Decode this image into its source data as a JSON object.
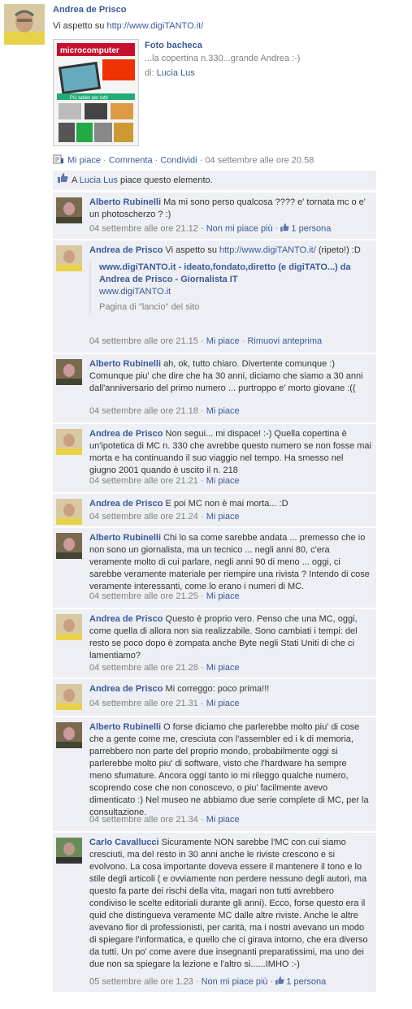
{
  "post": {
    "author": "Andrea de Prisco",
    "text_prefix": "Vi aspetto su ",
    "text_link": "http://www.digiTANTO.it/",
    "attachment": {
      "title": "Foto bacheca",
      "caption": "...la copertina n.330...grande Andrea :-)",
      "by_label": "di:",
      "by_name": "Lucia Lus",
      "thumb_masthead": "microcomputer",
      "thumb_subtitle": "Più tablet per tutti"
    },
    "actions": {
      "like": "Mi piace",
      "comment": "Commenta",
      "share": "Condividi",
      "timestamp": "04 settembre alle ore 20.58",
      "sep": "·"
    },
    "likes": {
      "prefix": "A",
      "name": "Lucia Lus",
      "suffix": "piace questo elemento."
    }
  },
  "comments": [
    {
      "author": "Alberto Rubinelli",
      "text": "Ma mi sono perso qualcosa ???? e' tornata mc o e' un photoscherzo ? :)",
      "time": "04 settembre alle ore 21.12",
      "actions": [
        "Non mi piace più"
      ],
      "likes_count": "1 persona"
    },
    {
      "author": "Andrea de Prisco",
      "text": "Vi aspetto su ",
      "link": "http://www.digiTANTO.it/",
      "text_after": " (ripeto!) :D",
      "preview": {
        "title": "www.digiTANTO.it - ideato,fondato,diretto (e digiTATO...) da Andrea de Prisco - Giornalista IT",
        "url": "www.digiTANTO.it",
        "desc": "Pagina di \"lancio\" del sito"
      },
      "time": "04 settembre alle ore 21.15",
      "actions": [
        "Mi piace",
        "Rimuovi anteprima"
      ]
    },
    {
      "author": "Alberto Rubinelli",
      "text": "ah, ok, tutto chiaro. Divertente comunque :) Comunque piu' che dire che ha 30 anni, diciamo che siamo a 30 anni dall'anniversario del primo numero ... purtroppo e' morto giovane :((",
      "time": "04 settembre alle ore 21.18",
      "actions": [
        "Mi piace"
      ]
    },
    {
      "author": "Andrea de Prisco",
      "text": "Non segui... mi dispace! :-) Quella copertina è un'ipotetica di MC n. 330 che avrebbe questo numero se non fosse mai morta e ha continuando il suo viaggio nel tempo. Ha smesso nel giugno 2001 quando è uscito il n. 218",
      "time": "04 settembre alle ore 21.21",
      "actions": [
        "Mi piace"
      ]
    },
    {
      "author": "Andrea de Prisco",
      "text": "E poi MC non è mai morta... :D",
      "time": "04 settembre alle ore 21.24",
      "actions": [
        "Mi piace"
      ]
    },
    {
      "author": "Alberto Rubinelli",
      "text": "Chi lo sa come sarebbe andata ... premesso che io non sono un giornalista, ma un tecnico ... negli anni 80, c'era veramente molto di cui parlare, negli anni 90 di meno ... oggi, ci sarebbe veramente materiale per riempire una rivista ? Intendo di cose veramente interessanti, come lo erano i numeri di MC.",
      "time": "04 settembre alle ore 21.25",
      "actions": [
        "Mi piace"
      ]
    },
    {
      "author": "Andrea de Prisco",
      "text": "Questo è proprio vero. Penso che una MC, oggi, come quella di allora non sia realizzabile. Sono cambiati i tempi: del resto se poco dopo è zompata anche Byte negli Stati Uniti di che ci lamentiamo?",
      "time": "04 settembre alle ore 21.28",
      "actions": [
        "Mi piace"
      ]
    },
    {
      "author": "Andrea de Prisco",
      "text": "Mi correggo: poco prima!!!",
      "time": "04 settembre alle ore 21.31",
      "actions": [
        "Mi piace"
      ]
    },
    {
      "author": "Alberto Rubinelli",
      "text": "O forse diciamo che parlerebbe molto piu' di cose che a gente come me, cresciuta con l'assembler ed i k di memoria, parrebbero non parte del proprio mondo, probabilmente oggi si parlerebbe molto piu' di software, visto che l'hardware ha sempre meno sfumature. Ancora oggi tanto io mi rileggo qualche numero, scoprendo cose che non conoscevo, o piu' facilmente avevo dimenticato :) Nel museo ne abbiamo due serie complete di MC, per la consultazione.",
      "time": "04 settembre alle ore 21.34",
      "actions": [
        "Mi piace"
      ]
    },
    {
      "author": "Carlo Cavallucci",
      "text": "Sicuramente NON sarebbe l'MC con cui siamo cresciuti, ma del resto in 30 anni anche le riviste crescono e si evolvono. La cosa importante doveva essere il mantenere il tono e lo stile degli articoli ( e ovviamente non perdere nessuno degli autori, ma questo fa parte dei rischi della vita, magari non tutti avrebbero condiviso le scelte editoriali durante gli anni). Ecco, forse questo era il quid che distingueva veramente MC dalle altre riviste. Anche le altre avevano fior di professionisti, per carità, ma i nostri avevano un modo di spiegare l'informatica, e quello che ci girava intorno, che era diverso da tutti. Un po' come avere due insegnanti preparatissimi, ma uno dei due non sa spiegare la lezione e l'altro si......IMHO :-)",
      "time": "05 settembre alle ore 1.23",
      "actions": [
        "Non mi piace più"
      ],
      "likes_count": "1 persona"
    }
  ]
}
